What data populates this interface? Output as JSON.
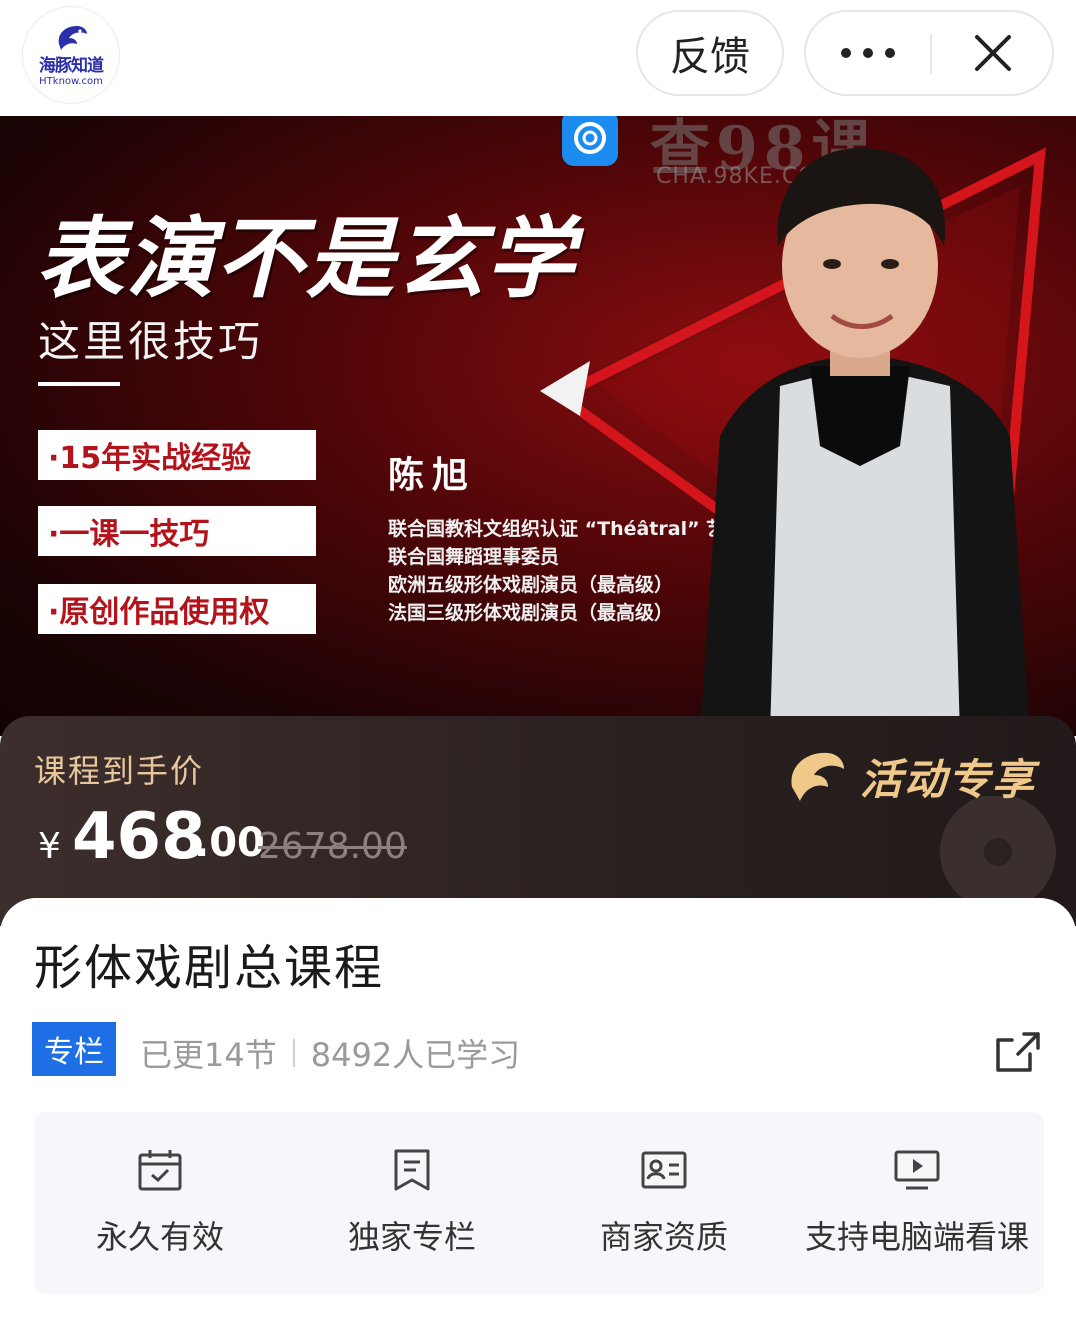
{
  "topbar": {
    "logo_cn": "海豚知道",
    "logo_en": "HTknow.com",
    "feedback_label": "反馈"
  },
  "watermark": {
    "title": "查98课",
    "subtitle": "CHA.98KE.COM"
  },
  "banner": {
    "title": "表演不是玄学",
    "subtitle": "这里很技巧",
    "features": [
      "·15年实战经验",
      "·一课一技巧",
      "·原创作品使用权"
    ],
    "teacher_name": "陈旭",
    "credentials": [
      "联合国教科文组织认证 “Théâtral” 艺术家",
      "联合国舞蹈理事委员",
      "欧洲五级形体戏剧演员（最高级）",
      "法国三级形体戏剧演员（最高级）"
    ]
  },
  "price": {
    "label": "课程到手价",
    "currency": "¥",
    "integer": "468",
    "decimal": ".00",
    "original": "2678.00",
    "promo": "活动专享",
    "accent_color": "#e8c79c"
  },
  "course": {
    "title": "形体戏剧总课程",
    "tag": "专栏",
    "updated": "已更14节",
    "learners": "8492人已学习"
  },
  "features": [
    {
      "icon": "calendar-check-icon",
      "label": "永久有效"
    },
    {
      "icon": "document-icon",
      "label": "独家专栏"
    },
    {
      "icon": "id-card-icon",
      "label": "商家资质"
    },
    {
      "icon": "monitor-play-icon",
      "label": "支持电脑端看课"
    }
  ],
  "colors": {
    "brand_blue": "#1e6fe6",
    "banner_red": "#8a0d10"
  }
}
